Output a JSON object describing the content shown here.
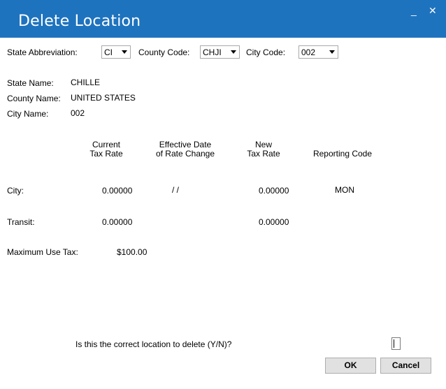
{
  "window": {
    "title": "Delete Location",
    "minimize_glyph": "_",
    "close_glyph": "✕"
  },
  "selectors": {
    "state_label": "State Abbreviation:",
    "state_value": "CI",
    "county_label": "County Code:",
    "county_value": "CHJI",
    "city_label": "City Code:",
    "city_value": "002"
  },
  "info": {
    "state_name_label": "State Name:",
    "state_name_value": "CHILLE",
    "county_name_label": "County Name:",
    "county_name_value": "UNITED STATES",
    "city_name_label": "City Name:",
    "city_name_value": "002"
  },
  "columns": {
    "current_line1": "Current",
    "current_line2": "Tax Rate",
    "effective_line1": "Effective Date",
    "effective_line2": "of Rate Change",
    "new_line1": "New",
    "new_line2": "Tax Rate",
    "reporting": "Reporting Code"
  },
  "rows": {
    "city_label": "City:",
    "city_current": "0.00000",
    "city_effective": "/ /",
    "city_new": "0.00000",
    "city_reporting": "MON",
    "transit_label": "Transit:",
    "transit_current": "0.00000",
    "transit_new": "0.00000",
    "max_use_label": "Maximum Use Tax:",
    "max_use_value": "$100.00"
  },
  "confirm": {
    "question": "Is this the correct location to delete (Y/N)?",
    "answer": ""
  },
  "buttons": {
    "ok": "OK",
    "cancel": "Cancel"
  }
}
